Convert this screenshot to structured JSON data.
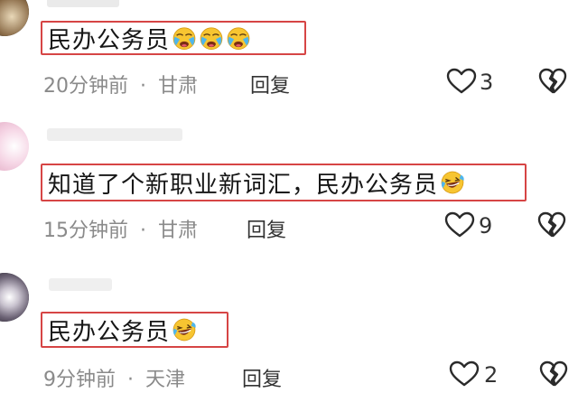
{
  "comments": [
    {
      "text": "民办公务员",
      "emojis": [
        "crying-face-emoji",
        "crying-face-emoji",
        "crying-face-emoji"
      ],
      "time": "20分钟前",
      "location": "甘肃",
      "reply_label": "回复",
      "likes": "3"
    },
    {
      "text": "知道了个新职业新词汇，民办公务员",
      "emojis": [
        "laughing-face-emoji"
      ],
      "time": "15分钟前",
      "location": "甘肃",
      "reply_label": "回复",
      "likes": "9"
    },
    {
      "text": "民办公务员",
      "emojis": [
        "laughing-face-emoji"
      ],
      "time": "9分钟前",
      "location": "天津",
      "reply_label": "回复",
      "likes": "2"
    }
  ],
  "meta_separator": "·",
  "colors": {
    "highlight_border": "#d64545",
    "meta_text": "#8a8a8a",
    "emoji_yellow": "#f7c531"
  }
}
